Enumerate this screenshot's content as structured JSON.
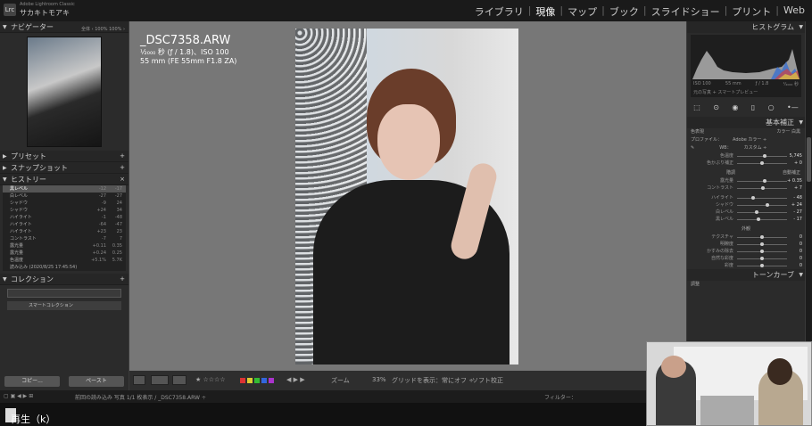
{
  "app": {
    "name": "Adobe Lightroom Classic",
    "user": "サカキトモアキ",
    "logo": "Lrc"
  },
  "modules": [
    "ライブラリ",
    "現像",
    "マップ",
    "ブック",
    "スライドショー",
    "プリント",
    "Web"
  ],
  "left": {
    "navigator": {
      "title": "ナビゲーター",
      "opts": "全体 ‹ 100% 100% ›"
    },
    "presets": "プリセット",
    "snapshots": "スナップショット",
    "history": {
      "title": "ヒストリー",
      "rows": [
        {
          "label": "黒レベル",
          "a": "-12",
          "b": "-17"
        },
        {
          "label": "白レベル",
          "a": "-27",
          "b": "-27"
        },
        {
          "label": "シャドウ",
          "a": "-9",
          "b": "24"
        },
        {
          "label": "シャドウ",
          "a": "+24",
          "b": "34"
        },
        {
          "label": "ハイライト",
          "a": "-1",
          "b": "-48"
        },
        {
          "label": "ハイライト",
          "a": "-64",
          "b": "-47"
        },
        {
          "label": "ハイライト",
          "a": "+23",
          "b": "23"
        },
        {
          "label": "コントラスト",
          "a": "-7",
          "b": "7"
        },
        {
          "label": "露光量",
          "a": "+0.11",
          "b": "0.35"
        },
        {
          "label": "露光量",
          "a": "+0.24",
          "b": "0.25"
        },
        {
          "label": "色温度",
          "a": "+5.1%",
          "b": "5.7K"
        },
        {
          "label": "読み込み (2020/8/25 17:45:54)",
          "a": "",
          "b": ""
        }
      ]
    },
    "collections": {
      "title": "コレクション",
      "smart": "スマートコレクション"
    },
    "copy": "コピー...",
    "paste": "ペースト"
  },
  "photo": {
    "filename": "_DSC7358.ARW",
    "exposure": "¹⁄₂₀₀₀ 秒 (ƒ / 1.8)、ISO 100",
    "lens": "55 mm (FE 55mm F1.8 ZA)"
  },
  "toolbar": {
    "zoom": "ズーム",
    "zoom_val": "33%",
    "grid": "グリッドを表示：常にオフ ÷",
    "soft": "ソフト校正"
  },
  "right": {
    "histogram": "ヒストグラム",
    "hmeta": [
      "ISO 100",
      "55 mm",
      "ƒ / 1.8",
      "¹⁄₂₀₀₀ 秒"
    ],
    "hprev": "元の写真 + スマートプレビュー",
    "basic": "基本補正",
    "treatment": "色表現",
    "color": "カラー",
    "bw": "白黒",
    "profile_label": "プロファイル：",
    "profile_val": "Adobe カラー ÷",
    "wb_label": "WB：",
    "wb_val": "カスタム ÷",
    "sliders_wb": [
      {
        "label": "色温度",
        "value": "5,745"
      },
      {
        "label": "色かぶり補正",
        "value": "+ 0"
      }
    ],
    "tone": "階調",
    "auto": "自動補正",
    "sliders_tone": [
      {
        "label": "露光量",
        "value": "+ 0.35"
      },
      {
        "label": "コントラスト",
        "value": "+ 7"
      }
    ],
    "sliders_tone2": [
      {
        "label": "ハイライト",
        "value": "- 48"
      },
      {
        "label": "シャドウ",
        "value": "+ 24"
      },
      {
        "label": "白レベル",
        "value": "- 27"
      },
      {
        "label": "黒レベル",
        "value": "- 17"
      }
    ],
    "presence": "外観",
    "sliders_presence": [
      {
        "label": "テクスチャ",
        "value": "0"
      },
      {
        "label": "明瞭度",
        "value": "0"
      },
      {
        "label": "かすみの除去",
        "value": "0"
      },
      {
        "label": "自然な彩度",
        "value": "0"
      },
      {
        "label": "彩度",
        "value": "0"
      }
    ],
    "tonecurve": "トーンカーブ",
    "adjust": "調整"
  },
  "filmstrip": {
    "text": "前回の読み込み  写真 1/1 枚表示 / _DSC7358.ARW ÷",
    "filter": "フィルター："
  },
  "play": "再生（k）"
}
